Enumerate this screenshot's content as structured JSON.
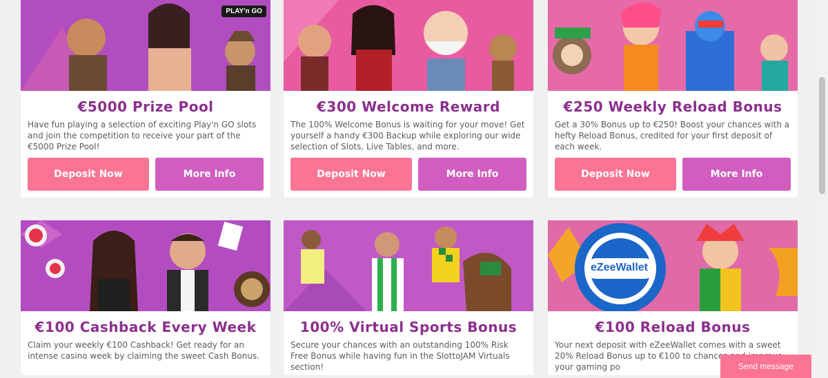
{
  "cards": [
    {
      "title": "€5000 Prize Pool",
      "description": "Have fun playing a selection of exciting Play'n GO slots and join the competition to receive your part of the €5000 Prize Pool!",
      "deposit_label": "Deposit Now",
      "info_label": "More Info",
      "banner_tag": "PLAY'n GO"
    },
    {
      "title": "€300 Welcome Reward",
      "description": "The 100% Welcome Bonus is waiting for your move! Get yourself a handy €300 Backup while exploring our wide selection of Slots, Live Tables, and more.",
      "deposit_label": "Deposit Now",
      "info_label": "More Info"
    },
    {
      "title": "€250 Weekly Reload Bonus",
      "description": "Get a 30% Bonus up to €250! Boost your chances with a hefty Reload Bonus, credited for your first deposit of each week.",
      "deposit_label": "Deposit Now",
      "info_label": "More Info"
    },
    {
      "title": "€100 Cashback Every Week",
      "description": "Claim your weekly €100 Cashback! Get ready for an intense casino week by claiming the sweet Cash Bonus."
    },
    {
      "title": "100% Virtual Sports Bonus",
      "description": "Secure your chances with an outstanding 100% Risk Free Bonus while having fun in the SlottoJAM Virtuals section!"
    },
    {
      "title": "€100 Reload Bonus",
      "description": "Your next deposit with eZeeWallet comes with a sweet 20% Reload Bonus up to €100 to chances and improve your gaming po",
      "banner_tag": "eZeeWallet"
    }
  ],
  "chat": {
    "label": "Send message"
  },
  "colors": {
    "title": "#8b2f8e",
    "deposit": "#fb7493",
    "info": "#d15dc0",
    "banner_pink": "#e75ba6",
    "banner_purple": "#b04ec6"
  }
}
